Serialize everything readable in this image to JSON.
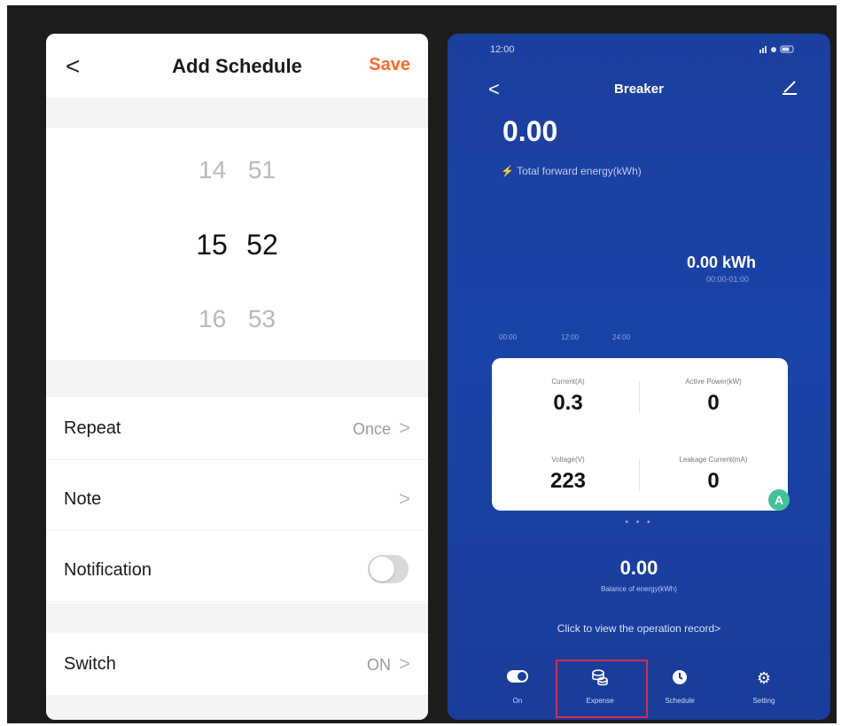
{
  "left": {
    "header": {
      "back_glyph": "<",
      "title": "Add Schedule",
      "save_label": "Save"
    },
    "picker": {
      "above": {
        "hour": "14",
        "minute": "51"
      },
      "selected": {
        "hour": "15",
        "minute": "52"
      },
      "below": {
        "hour": "16",
        "minute": "53"
      }
    },
    "rows": {
      "repeat": {
        "label": "Repeat",
        "value": "Once"
      },
      "note": {
        "label": "Note"
      },
      "notification": {
        "label": "Notification",
        "state": "off"
      },
      "switch": {
        "label": "Switch",
        "value": "ON"
      }
    },
    "chevron": ">"
  },
  "right": {
    "status_bar": {
      "time": "12:00",
      "icons": "signal wifi battery"
    },
    "header": {
      "back_glyph": "<",
      "title": "Breaker"
    },
    "energy": {
      "value": "0.00",
      "label": "Total forward energy(kWh)"
    },
    "kwh": {
      "value": "0.00 kWh",
      "range": "00:00-01:00"
    },
    "timeline": [
      "00:00",
      "12:00",
      "24:00"
    ],
    "metrics": {
      "current": {
        "label": "Current(A)",
        "value": "0.3"
      },
      "active_power": {
        "label": "Active Power(kW)",
        "value": "0"
      },
      "voltage": {
        "label": "Voltage(V)",
        "value": "223"
      },
      "leakage": {
        "label": "Leakage Current(mA)",
        "value": "0"
      }
    },
    "badge": "A",
    "page_dots": "• • •",
    "balance": {
      "value": "0.00",
      "label": "Balance of energy(kWh)"
    },
    "operation_link": "Click to view the operation record>",
    "nav": [
      {
        "label": "On",
        "icon": "toggle-icon"
      },
      {
        "label": "Expense",
        "icon": "coins-icon"
      },
      {
        "label": "Schedule",
        "icon": "clock-icon"
      },
      {
        "label": "Setting",
        "icon": "gear-icon"
      }
    ],
    "colors": {
      "bg": "#1b3f9f",
      "highlight": "#d42d4e",
      "accent": "#ff6a2b"
    }
  }
}
